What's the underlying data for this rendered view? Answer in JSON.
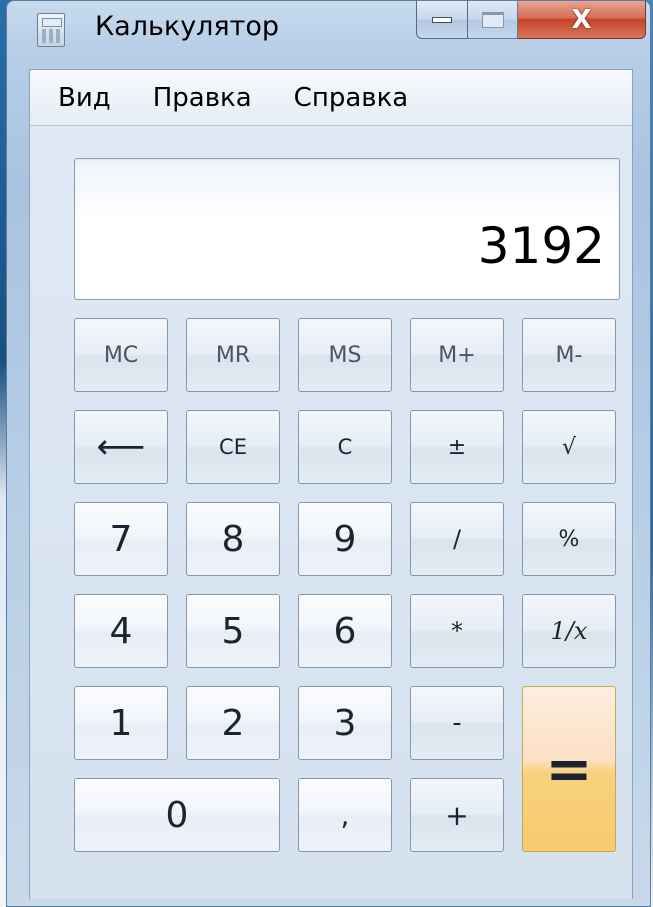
{
  "window": {
    "title": "Калькулятор",
    "close_label": "X"
  },
  "menu": {
    "items": [
      "Вид",
      "Правка",
      "Справка"
    ]
  },
  "display": {
    "value": "3192"
  },
  "keys": {
    "mc": "MC",
    "mr": "MR",
    "ms": "MS",
    "mplus": "M+",
    "mminus": "M-",
    "backspace": "⟵",
    "ce": "CE",
    "c": "C",
    "plusminus": "±",
    "sqrt": "√",
    "d7": "7",
    "d8": "8",
    "d9": "9",
    "div": "/",
    "percent": "%",
    "d4": "4",
    "d5": "5",
    "d6": "6",
    "mul": "*",
    "recip": "1/x",
    "d1": "1",
    "d2": "2",
    "d3": "3",
    "minus": "-",
    "equals": "=",
    "d0": "0",
    "dot": ",",
    "plus": "+"
  },
  "colors": {
    "equals_accent": "#f9d17e",
    "close_button": "#c3432a"
  }
}
